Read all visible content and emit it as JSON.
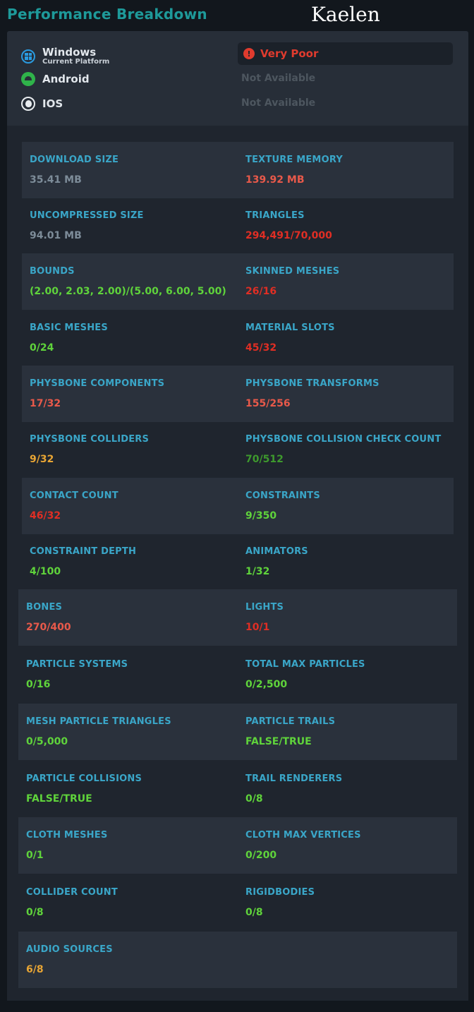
{
  "header": {
    "title": "Performance Breakdown",
    "username": "Kaelen"
  },
  "platforms": {
    "windows": {
      "name": "Windows",
      "subtitle": "Current Platform",
      "rating": "Very Poor"
    },
    "android": {
      "name": "Android",
      "status": "Not Available"
    },
    "ios": {
      "name": "IOS",
      "status": "Not Available"
    }
  },
  "colors": {
    "neutral": "#7d8c99",
    "good": "#5fd33b",
    "good_dark": "#3e9a2d",
    "medium": "#e8a534",
    "poor": "#e8594a",
    "very_poor": "#e02e24",
    "accent": "#1e9a9a",
    "label": "#3aa6c8"
  },
  "stats": [
    {
      "left": {
        "label": "DOWNLOAD SIZE",
        "value": "35.41 MB",
        "status": "neutral"
      },
      "right": {
        "label": "TEXTURE MEMORY",
        "value": "139.92 MB",
        "status": "poor"
      }
    },
    {
      "left": {
        "label": "UNCOMPRESSED SIZE",
        "value": "94.01 MB",
        "status": "neutral"
      },
      "right": {
        "label": "TRIANGLES",
        "value": "294,491/70,000",
        "status": "very_poor"
      }
    },
    {
      "left": {
        "label": "BOUNDS",
        "value": "(2.00, 2.03, 2.00)/(5.00, 6.00, 5.00)",
        "status": "good"
      },
      "right": {
        "label": "SKINNED MESHES",
        "value": "26/16",
        "status": "very_poor"
      }
    },
    {
      "left": {
        "label": "BASIC MESHES",
        "value": "0/24",
        "status": "good"
      },
      "right": {
        "label": "MATERIAL SLOTS",
        "value": "45/32",
        "status": "very_poor"
      }
    },
    {
      "left": {
        "label": "PHYSBONE COMPONENTS",
        "value": "17/32",
        "status": "poor"
      },
      "right": {
        "label": "PHYSBONE TRANSFORMS",
        "value": "155/256",
        "status": "poor"
      }
    },
    {
      "left": {
        "label": "PHYSBONE COLLIDERS",
        "value": "9/32",
        "status": "medium"
      },
      "right": {
        "label": "PHYSBONE COLLISION CHECK COUNT",
        "value": "70/512",
        "status": "good_dark"
      }
    },
    {
      "left": {
        "label": "CONTACT COUNT",
        "value": "46/32",
        "status": "very_poor"
      },
      "right": {
        "label": "CONSTRAINTS",
        "value": "9/350",
        "status": "good"
      }
    },
    {
      "left": {
        "label": "CONSTRAINT DEPTH",
        "value": "4/100",
        "status": "good"
      },
      "right": {
        "label": "ANIMATORS",
        "value": "1/32",
        "status": "good"
      }
    },
    {
      "left": {
        "label": "BONES",
        "value": "270/400",
        "status": "poor"
      },
      "right": {
        "label": "LIGHTS",
        "value": "10/1",
        "status": "very_poor"
      }
    },
    {
      "left": {
        "label": "PARTICLE SYSTEMS",
        "value": "0/16",
        "status": "good"
      },
      "right": {
        "label": "TOTAL MAX PARTICLES",
        "value": "0/2,500",
        "status": "good"
      }
    },
    {
      "left": {
        "label": "MESH PARTICLE TRIANGLES",
        "value": "0/5,000",
        "status": "good"
      },
      "right": {
        "label": "PARTICLE TRAILS",
        "value": "FALSE/TRUE",
        "status": "good"
      }
    },
    {
      "left": {
        "label": "PARTICLE COLLISIONS",
        "value": "FALSE/TRUE",
        "status": "good"
      },
      "right": {
        "label": "TRAIL RENDERERS",
        "value": "0/8",
        "status": "good"
      }
    },
    {
      "left": {
        "label": "CLOTH MESHES",
        "value": "0/1",
        "status": "good"
      },
      "right": {
        "label": "CLOTH MAX VERTICES",
        "value": "0/200",
        "status": "good"
      }
    },
    {
      "left": {
        "label": "COLLIDER COUNT",
        "value": "0/8",
        "status": "good"
      },
      "right": {
        "label": "RIGIDBODIES",
        "value": "0/8",
        "status": "good"
      }
    },
    {
      "left": {
        "label": "AUDIO SOURCES",
        "value": "6/8",
        "status": "medium"
      }
    }
  ]
}
